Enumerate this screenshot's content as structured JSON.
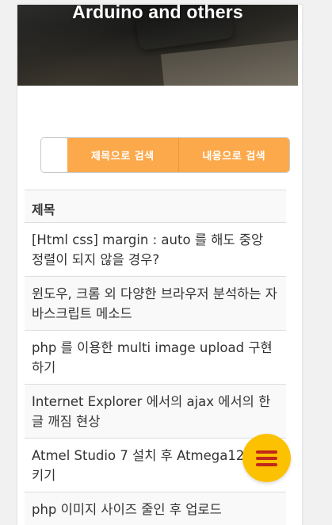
{
  "hero": {
    "title": "Arduino and others"
  },
  "search": {
    "input_value": "",
    "title_search_label": "제목으로 검색",
    "content_search_label": "내용으로 검색"
  },
  "list": {
    "header": "제목",
    "items": [
      "[Html css] margin : auto 를 해도 중앙 정렬이 되지 않을 경우?",
      "윈도우, 크롬 외 다양한 브라우저 분석하는 자바스크립트 메소드",
      "php 를 이용한 multi image upload 구현하기",
      "Internet Explorer 에서의 ajax 에서의 한글 깨짐 현상",
      "Atmel Studio 7 설치 후 Atmega128 시키기",
      "php 이미지 사이즈 줄인 후 업로드"
    ]
  },
  "fab": {
    "icon": "hamburger-menu-icon"
  },
  "colors": {
    "search_button": "#fca94c",
    "fab_background": "#fcc100",
    "fab_icon": "#c0281b"
  }
}
